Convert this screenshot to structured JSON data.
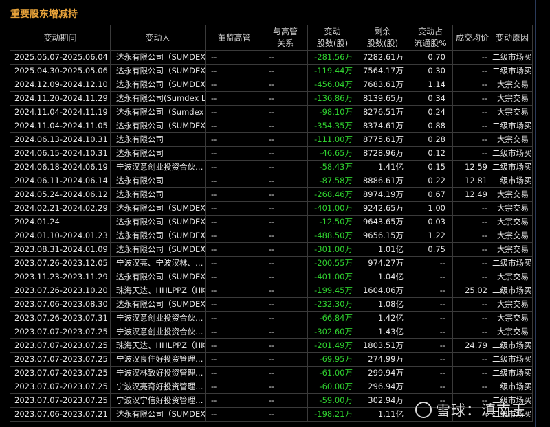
{
  "panel": {
    "title": "重要股东增减持"
  },
  "table": {
    "headers": {
      "date": "变动期间",
      "person": "变动人",
      "gj": "董监高管",
      "rel": [
        "与高管",
        "关系"
      ],
      "chg": [
        "变动",
        "股数(股)"
      ],
      "rem": [
        "剩余",
        "股数(股)"
      ],
      "pct": [
        "变动占",
        "流通股%"
      ],
      "avg": "成交均价",
      "reason": "变动原因"
    },
    "rows": [
      {
        "date": "2025.05.07-2025.06.04",
        "person": "达永有限公司（SUMDEX L",
        "gj": "--",
        "rel": "--",
        "chg": "-281.56万",
        "rem": "7282.61万",
        "pct": "0.70",
        "avg": "--",
        "reason": "二级市场买卖"
      },
      {
        "date": "2025.04.30-2025.05.06",
        "person": "达永有限公司（SUMDEX L",
        "gj": "--",
        "rel": "--",
        "chg": "-119.44万",
        "rem": "7564.17万",
        "pct": "0.30",
        "avg": "--",
        "reason": "二级市场买卖"
      },
      {
        "date": "2024.12.09-2024.12.10",
        "person": "达永有限公司（SUMDEX L",
        "gj": "--",
        "rel": "--",
        "chg": "-456.04万",
        "rem": "7683.61万",
        "pct": "1.14",
        "avg": "--",
        "reason": "大宗交易"
      },
      {
        "date": "2024.11.20-2024.11.29",
        "person": "达永有限公司(Sumdex L",
        "gj": "--",
        "rel": "--",
        "chg": "-136.86万",
        "rem": "8139.65万",
        "pct": "0.34",
        "avg": "--",
        "reason": "大宗交易"
      },
      {
        "date": "2024.11.04-2024.11.19",
        "person": "达永有限公司（Sumdex L",
        "gj": "--",
        "rel": "--",
        "chg": "-98.10万",
        "rem": "8276.51万",
        "pct": "0.24",
        "avg": "--",
        "reason": "大宗交易"
      },
      {
        "date": "2024.11.04-2024.11.05",
        "person": "达永有限公司（SUMDEX L",
        "gj": "--",
        "rel": "--",
        "chg": "-354.35万",
        "rem": "8374.61万",
        "pct": "0.88",
        "avg": "--",
        "reason": "二级市场买卖"
      },
      {
        "date": "2024.06.13-2024.10.31",
        "person": "达永有限公司",
        "gj": "--",
        "rel": "--",
        "chg": "-111.00万",
        "rem": "8775.61万",
        "pct": "0.28",
        "avg": "--",
        "reason": "大宗交易"
      },
      {
        "date": "2024.06.15-2024.10.31",
        "person": "达永有限公司",
        "gj": "--",
        "rel": "--",
        "chg": "-46.65万",
        "rem": "8728.96万",
        "pct": "0.12",
        "avg": "--",
        "reason": "二级市场买卖"
      },
      {
        "date": "2024.06.18-2024.06.19",
        "person": "宁波汉意创业投资合伙…",
        "gj": "--",
        "rel": "--",
        "chg": "-58.43万",
        "rem": "1.41亿",
        "pct": "0.15",
        "avg": "12.59",
        "reason": "二级市场买卖"
      },
      {
        "date": "2024.06.11-2024.06.14",
        "person": "达永有限公司",
        "gj": "--",
        "rel": "--",
        "chg": "-87.58万",
        "rem": "8886.61万",
        "pct": "0.22",
        "avg": "12.81",
        "reason": "二级市场买卖"
      },
      {
        "date": "2024.05.24-2024.06.12",
        "person": "达永有限公司",
        "gj": "--",
        "rel": "--",
        "chg": "-268.46万",
        "rem": "8974.19万",
        "pct": "0.67",
        "avg": "12.49",
        "reason": "大宗交易"
      },
      {
        "date": "2024.02.21-2024.02.29",
        "person": "达永有限公司（SUMDEX L",
        "gj": "--",
        "rel": "--",
        "chg": "-401.00万",
        "rem": "9242.65万",
        "pct": "1.00",
        "avg": "--",
        "reason": "大宗交易"
      },
      {
        "date": "2024.01.24",
        "person": "达永有限公司（SUMDEX L",
        "gj": "--",
        "rel": "--",
        "chg": "-12.50万",
        "rem": "9643.65万",
        "pct": "0.03",
        "avg": "--",
        "reason": "大宗交易"
      },
      {
        "date": "2024.01.10-2024.01.23",
        "person": "达永有限公司（SUMDEX L",
        "gj": "--",
        "rel": "--",
        "chg": "-488.50万",
        "rem": "9656.15万",
        "pct": "1.22",
        "avg": "--",
        "reason": "大宗交易"
      },
      {
        "date": "2023.08.31-2024.01.09",
        "person": "达永有限公司（SUMDEX L",
        "gj": "--",
        "rel": "--",
        "chg": "-301.00万",
        "rem": "1.01亿",
        "pct": "0.75",
        "avg": "--",
        "reason": "大宗交易"
      },
      {
        "date": "2023.07.26-2023.12.05",
        "person": "宁波汉亮、宁波汉林、…",
        "gj": "--",
        "rel": "--",
        "chg": "-200.55万",
        "rem": "974.27万",
        "pct": "--",
        "avg": "--",
        "reason": "二级市场买卖"
      },
      {
        "date": "2023.11.23-2023.11.29",
        "person": "达永有限公司（SUMDEX L",
        "gj": "--",
        "rel": "--",
        "chg": "-401.00万",
        "rem": "1.04亿",
        "pct": "--",
        "avg": "--",
        "reason": "大宗交易"
      },
      {
        "date": "2023.07.26-2023.10.20",
        "person": "珠海天达、HHLPPZ（HK…",
        "gj": "--",
        "rel": "--",
        "chg": "-199.45万",
        "rem": "1604.06万",
        "pct": "--",
        "avg": "25.02",
        "reason": "二级市场买卖"
      },
      {
        "date": "2023.07.06-2023.08.30",
        "person": "达永有限公司（SUMDEX L",
        "gj": "--",
        "rel": "--",
        "chg": "-232.30万",
        "rem": "1.08亿",
        "pct": "--",
        "avg": "--",
        "reason": "大宗交易"
      },
      {
        "date": "2023.07.26-2023.07.31",
        "person": "宁波汉意创业投资合伙…",
        "gj": "--",
        "rel": "--",
        "chg": "-66.84万",
        "rem": "1.42亿",
        "pct": "--",
        "avg": "--",
        "reason": "大宗交易"
      },
      {
        "date": "2023.07.07-2023.07.25",
        "person": "宁波汉意创业投资合伙…",
        "gj": "--",
        "rel": "--",
        "chg": "-302.60万",
        "rem": "1.43亿",
        "pct": "--",
        "avg": "--",
        "reason": "大宗交易"
      },
      {
        "date": "2023.07.07-2023.07.25",
        "person": "珠海天达、HHLPPZ（HK…",
        "gj": "--",
        "rel": "--",
        "chg": "-201.49万",
        "rem": "1803.51万",
        "pct": "--",
        "avg": "24.79",
        "reason": "二级市场买卖"
      },
      {
        "date": "2023.07.07-2023.07.25",
        "person": "宁波汉良佳好投资管理…",
        "gj": "--",
        "rel": "--",
        "chg": "-69.95万",
        "rem": "274.99万",
        "pct": "--",
        "avg": "--",
        "reason": "二级市场买卖"
      },
      {
        "date": "2023.07.07-2023.07.25",
        "person": "宁波汉林致好投资管理…",
        "gj": "--",
        "rel": "--",
        "chg": "-61.00万",
        "rem": "299.94万",
        "pct": "--",
        "avg": "--",
        "reason": "二级市场买卖"
      },
      {
        "date": "2023.07.07-2023.07.25",
        "person": "宁波汉亮奇好投资管理…",
        "gj": "--",
        "rel": "--",
        "chg": "-60.00万",
        "rem": "296.94万",
        "pct": "--",
        "avg": "--",
        "reason": "二级市场买卖"
      },
      {
        "date": "2023.07.07-2023.07.25",
        "person": "宁波汉宁信好投资管理…",
        "gj": "--",
        "rel": "--",
        "chg": "-59.00万",
        "rem": "302.94万",
        "pct": "--",
        "avg": "--",
        "reason": "二级市场买卖"
      },
      {
        "date": "2023.07.06-2023.07.21",
        "person": "达永有限公司（SUMDEX L",
        "gj": "--",
        "rel": "--",
        "chg": "-198.21万",
        "rem": "1.11亿",
        "pct": "--",
        "avg": "--",
        "reason": "二级市场买卖"
      }
    ]
  },
  "watermark": {
    "text": "雪球：滇南王",
    "icon": "snowball-logo-icon"
  }
}
